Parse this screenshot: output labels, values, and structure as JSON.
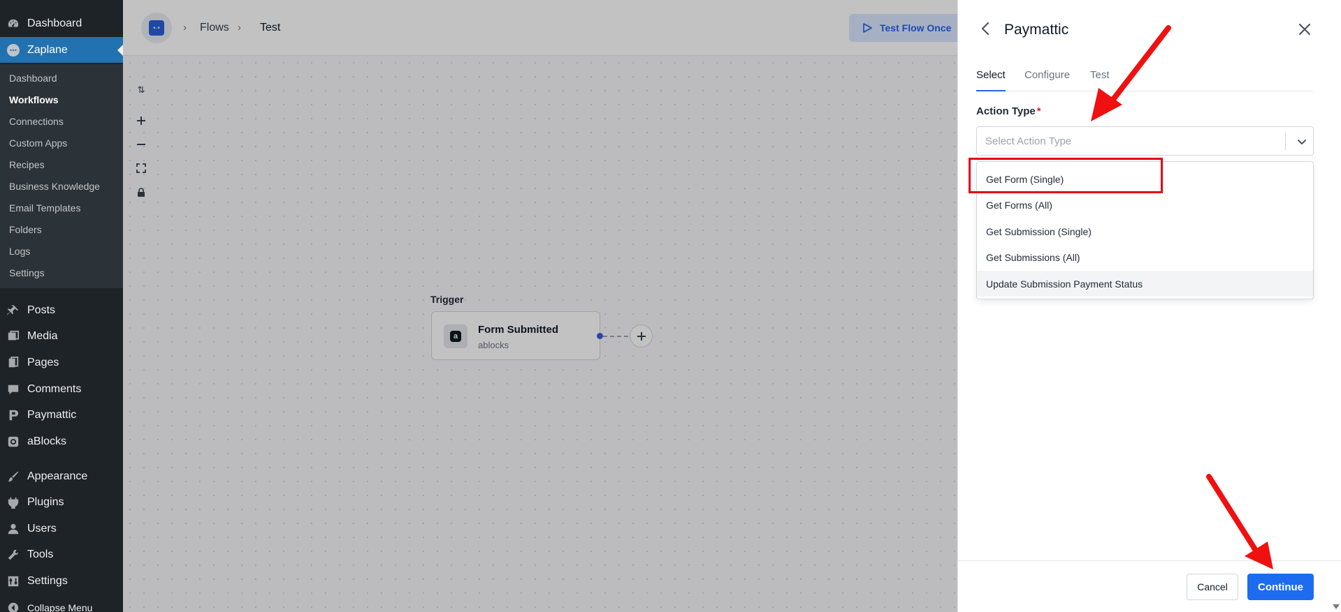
{
  "wp_menu": {
    "dashboard": "Dashboard",
    "zaplane": "Zaplane",
    "submenu": [
      "Dashboard",
      "Workflows",
      "Connections",
      "Custom Apps",
      "Recipes",
      "Business Knowledge",
      "Email Templates",
      "Folders",
      "Logs",
      "Settings"
    ],
    "current_submenu": "Workflows",
    "items": [
      {
        "label": "Posts",
        "icon": "pushpin-icon"
      },
      {
        "label": "Media",
        "icon": "media-icon"
      },
      {
        "label": "Pages",
        "icon": "pages-icon"
      },
      {
        "label": "Comments",
        "icon": "comment-icon"
      },
      {
        "label": "Paymattic",
        "icon": "paymattic-icon"
      },
      {
        "label": "aBlocks",
        "icon": "ablocks-icon"
      },
      {
        "label": "Appearance",
        "icon": "paintbrush-icon"
      },
      {
        "label": "Plugins",
        "icon": "plugin-icon"
      },
      {
        "label": "Users",
        "icon": "user-icon"
      },
      {
        "label": "Tools",
        "icon": "wrench-icon"
      },
      {
        "label": "Settings",
        "icon": "settings-icon"
      },
      {
        "label": "Collapse Menu",
        "icon": "collapse-icon"
      }
    ]
  },
  "flow": {
    "breadcrumb": [
      "Flows",
      "Test"
    ],
    "test_flow_label": "Test Flow Once",
    "trigger_label": "Trigger",
    "trigger_node": {
      "title": "Form Submitted",
      "subtitle": "ablocks"
    },
    "canvas_tools": [
      "swap-icon",
      "zoom-in-icon",
      "zoom-out-icon",
      "fit-view-icon",
      "lock-icon"
    ]
  },
  "panel": {
    "title": "Paymattic",
    "tabs": [
      "Select",
      "Configure",
      "Test"
    ],
    "active_tab": "Select",
    "field_label": "Action Type",
    "required_mark": "*",
    "placeholder": "Select Action Type",
    "options": [
      "Get Form (Single)",
      "Get Forms (All)",
      "Get Submission (Single)",
      "Get Submissions (All)",
      "Update Submission Payment Status"
    ],
    "hovered_option": "Update Submission Payment Status",
    "cancel_label": "Cancel",
    "continue_label": "Continue"
  },
  "colors": {
    "wp_sidebar": "#1d2327",
    "wp_active": "#2271b1",
    "accent": "#1d6cf0",
    "annotation": "#e3001b"
  }
}
